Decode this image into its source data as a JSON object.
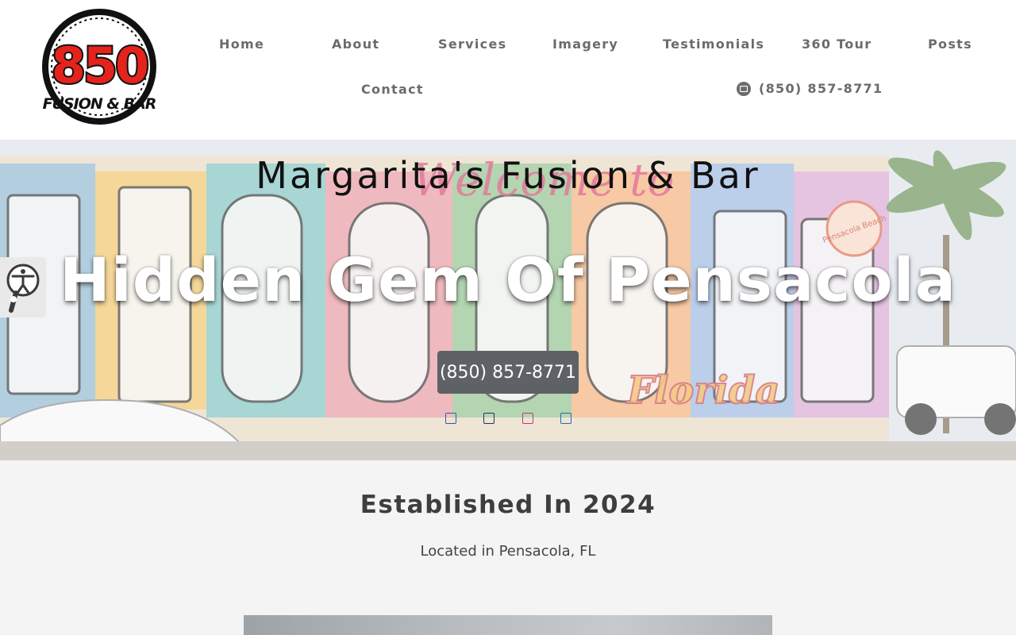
{
  "brand": {
    "logo_number": "850",
    "logo_text": "FUSION & BAR"
  },
  "nav": {
    "items": [
      {
        "label": "Home"
      },
      {
        "label": "About"
      },
      {
        "label": "Services"
      },
      {
        "label": "Imagery"
      },
      {
        "label": "Testimonials"
      },
      {
        "label": "360 Tour"
      },
      {
        "label": "Posts"
      },
      {
        "label": "Contact"
      }
    ],
    "phone": "(850) 857-8771"
  },
  "hero": {
    "subtitle": "Margarita's Fusion & Bar",
    "title": "Hidden Gem Of Pensacola",
    "button_label": "(850) 857-8771",
    "social_icons": [
      "facebook-icon",
      "twitter-icon",
      "instagram-icon",
      "linkedin-icon"
    ],
    "mural_text": {
      "welcome": "Welcome to",
      "beach": "Pensacola Beach",
      "florida": "Florida"
    }
  },
  "about": {
    "heading": "Established In 2024",
    "location": "Located in Pensacola, FL"
  },
  "colors": {
    "nav_text": "#6b6b6b",
    "button_bg": "#5e6166",
    "logo_red": "#e3231c",
    "page_bg": "#f4f4f4"
  }
}
